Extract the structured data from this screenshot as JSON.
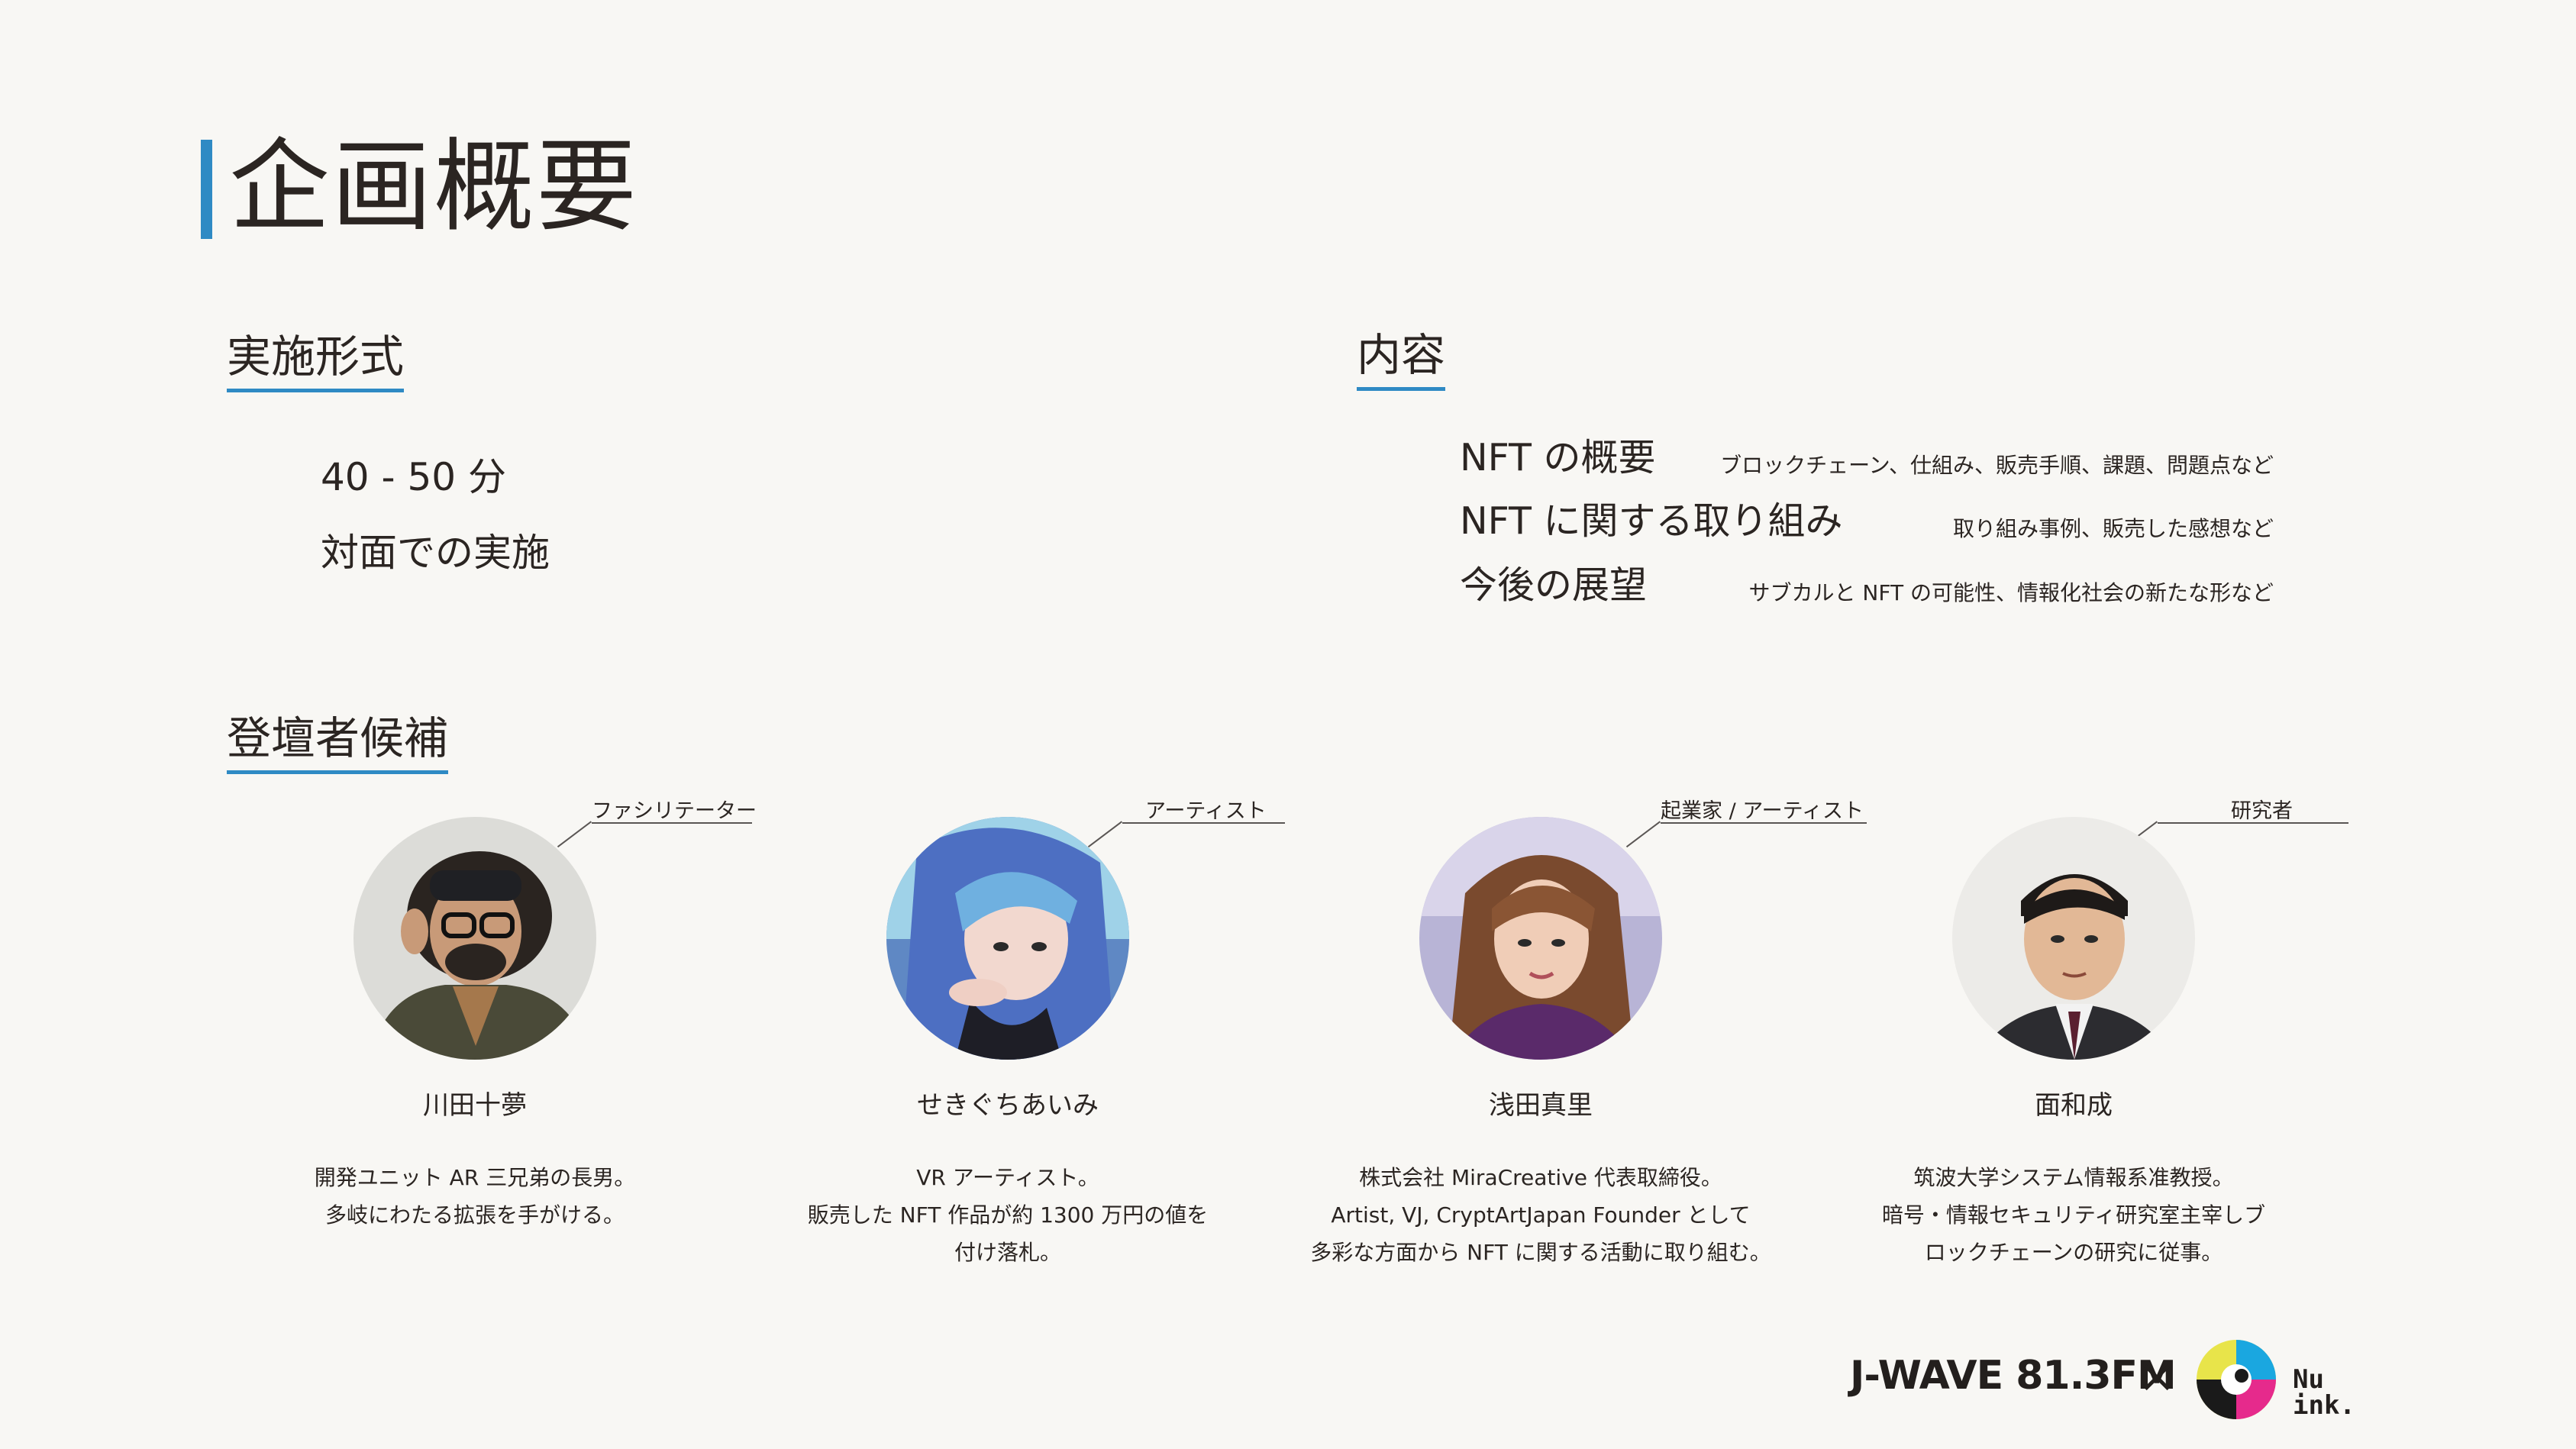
{
  "page": {
    "title": "企画概要"
  },
  "format": {
    "heading": "実施形式",
    "duration": "40 - 50 分",
    "style": "対面での実施"
  },
  "content": {
    "heading": "内容",
    "items": [
      {
        "title": "NFT の概要",
        "note": "ブロックチェーン、仕組み、販売手順、課題、問題点など"
      },
      {
        "title": "NFT に関する取り組み",
        "note": "取り組み事例、販売した感想など"
      },
      {
        "title": "今後の展望",
        "note": "サブカルと NFT の可能性、情報化社会の新たな形など"
      }
    ]
  },
  "speakers": {
    "heading": "登壇者候補",
    "list": [
      {
        "role": "ファシリテーター",
        "name": "川田十夢",
        "bio": [
          "開発ユニット AR 三兄弟の長男。",
          "多岐にわたる拡張を手がける。"
        ]
      },
      {
        "role": "アーティスト",
        "name": "せきぐちあいみ",
        "bio": [
          "VR アーティスト。",
          "販売した NFT 作品が約 1300 万円の値を",
          "付け落札。"
        ]
      },
      {
        "role": "起業家 / アーティスト",
        "name": "浅田真里",
        "bio": [
          "株式会社 MiraCreative 代表取締役。",
          "Artist, VJ, CryptArtJapan Founder として",
          "多彩な方面から NFT に関する活動に取り組む。"
        ]
      },
      {
        "role": "研究者",
        "name": "面和成",
        "bio": [
          "筑波大学システム情報系准教授。",
          "暗号・情報セキュリティ研究室主宰しブ",
          "ロックチェーンの研究に従事。"
        ]
      }
    ]
  },
  "footer": {
    "jwave_logo": "J-WAVE 81.3FM",
    "times": "×",
    "nuink_logo_line1": "Nu",
    "nuink_logo_line2": "ink."
  },
  "colors": {
    "accent": "#2f8ac4",
    "background": "#f8f7f4",
    "text": "#2b2522"
  }
}
